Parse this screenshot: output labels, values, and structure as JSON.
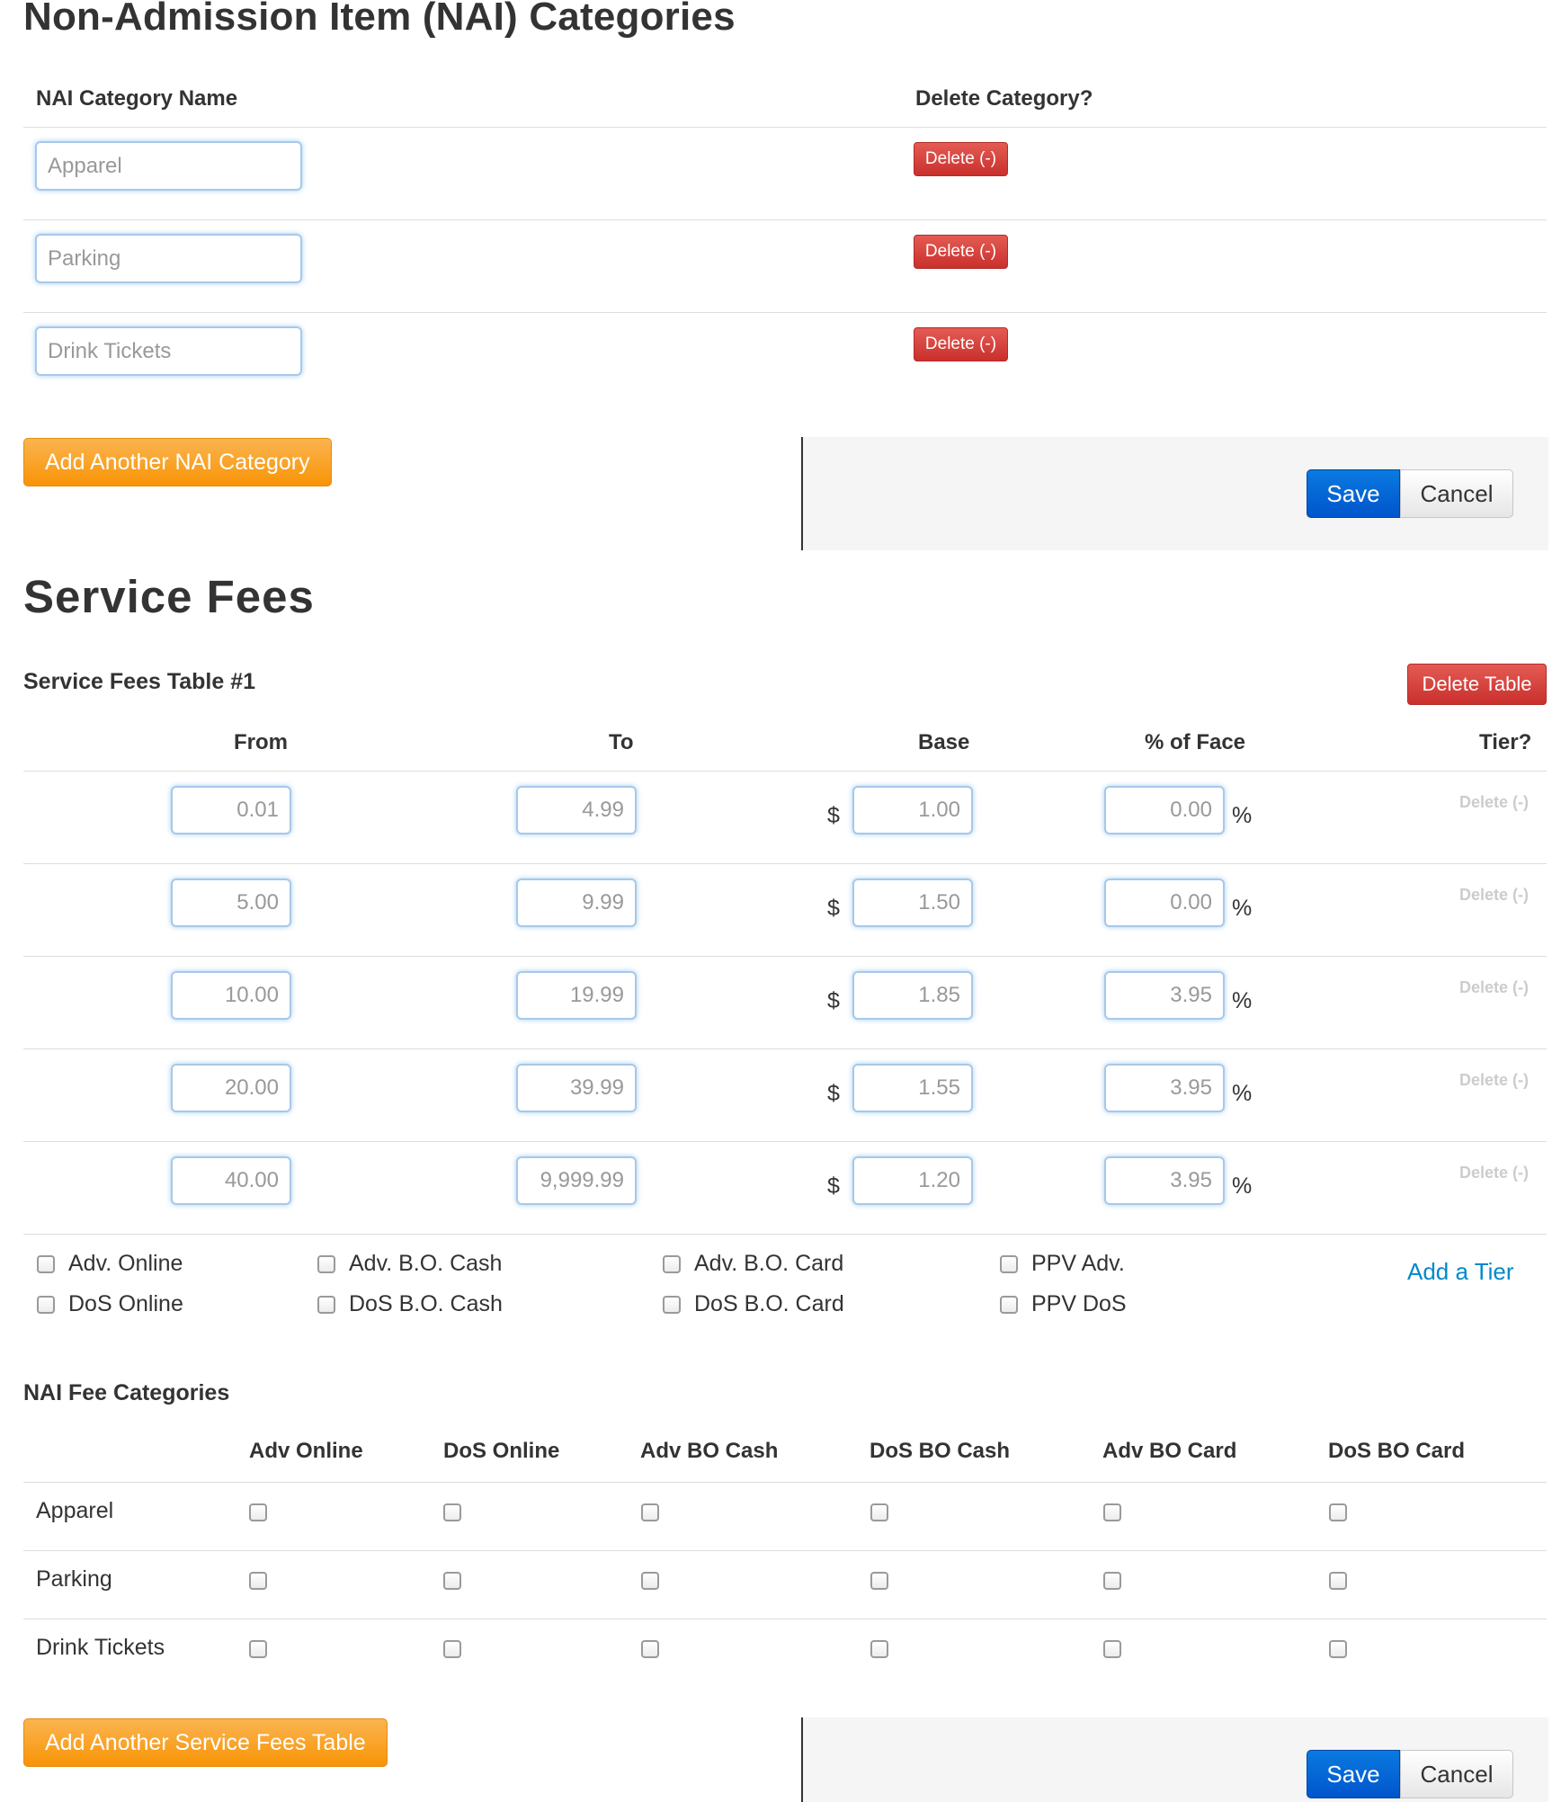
{
  "nai": {
    "title": "Non-Admission Item (NAI) Categories",
    "col_name": "NAI Category Name",
    "col_delete": "Delete Category?",
    "categories": [
      {
        "value": "Apparel",
        "delete_label": "Delete (-)"
      },
      {
        "value": "Parking",
        "delete_label": "Delete (-)"
      },
      {
        "value": "Drink Tickets",
        "delete_label": "Delete (-)"
      }
    ],
    "add_label": "Add Another NAI Category",
    "save_label": "Save",
    "cancel_label": "Cancel"
  },
  "service_fees": {
    "title": "Service Fees",
    "table_title": "Service Fees Table #1",
    "delete_table_label": "Delete Table",
    "columns": {
      "from": "From",
      "to": "To",
      "base": "Base",
      "pct_face": "% of Face",
      "tier": "Tier?"
    },
    "currency_symbol": "$",
    "percent_symbol": "%",
    "tiers": [
      {
        "from": "0.01",
        "to": "4.99",
        "base": "1.00",
        "pct": "0.00",
        "delete_label": "Delete (-)"
      },
      {
        "from": "5.00",
        "to": "9.99",
        "base": "1.50",
        "pct": "0.00",
        "delete_label": "Delete (-)"
      },
      {
        "from": "10.00",
        "to": "19.99",
        "base": "1.85",
        "pct": "3.95",
        "delete_label": "Delete (-)"
      },
      {
        "from": "20.00",
        "to": "39.99",
        "base": "1.55",
        "pct": "3.95",
        "delete_label": "Delete (-)"
      },
      {
        "from": "40.00",
        "to": "9,999.99",
        "base": "1.20",
        "pct": "3.95",
        "delete_label": "Delete (-)"
      }
    ],
    "channels": [
      {
        "label": "Adv. Online",
        "checked": false
      },
      {
        "label": "DoS Online",
        "checked": false
      },
      {
        "label": "Adv. B.O. Cash",
        "checked": false
      },
      {
        "label": "DoS B.O. Cash",
        "checked": false
      },
      {
        "label": "Adv. B.O. Card",
        "checked": false
      },
      {
        "label": "DoS B.O. Card",
        "checked": false
      },
      {
        "label": "PPV Adv.",
        "checked": false
      },
      {
        "label": "PPV DoS",
        "checked": false
      }
    ],
    "add_tier_label": "Add a Tier",
    "nai_fee": {
      "title": "NAI Fee Categories",
      "columns": [
        "Adv Online",
        "DoS Online",
        "Adv BO Cash",
        "DoS BO Cash",
        "Adv BO Card",
        "DoS BO Card"
      ],
      "rows": [
        "Apparel",
        "Parking",
        "Drink Tickets"
      ]
    },
    "add_table_label": "Add Another Service Fees Table",
    "save_label": "Save",
    "cancel_label": "Cancel"
  },
  "colors": {
    "accent_blue": "#0a7ae0",
    "danger_red": "#c9302c",
    "warning_orange": "#f89406",
    "link_blue": "#0088cc"
  }
}
